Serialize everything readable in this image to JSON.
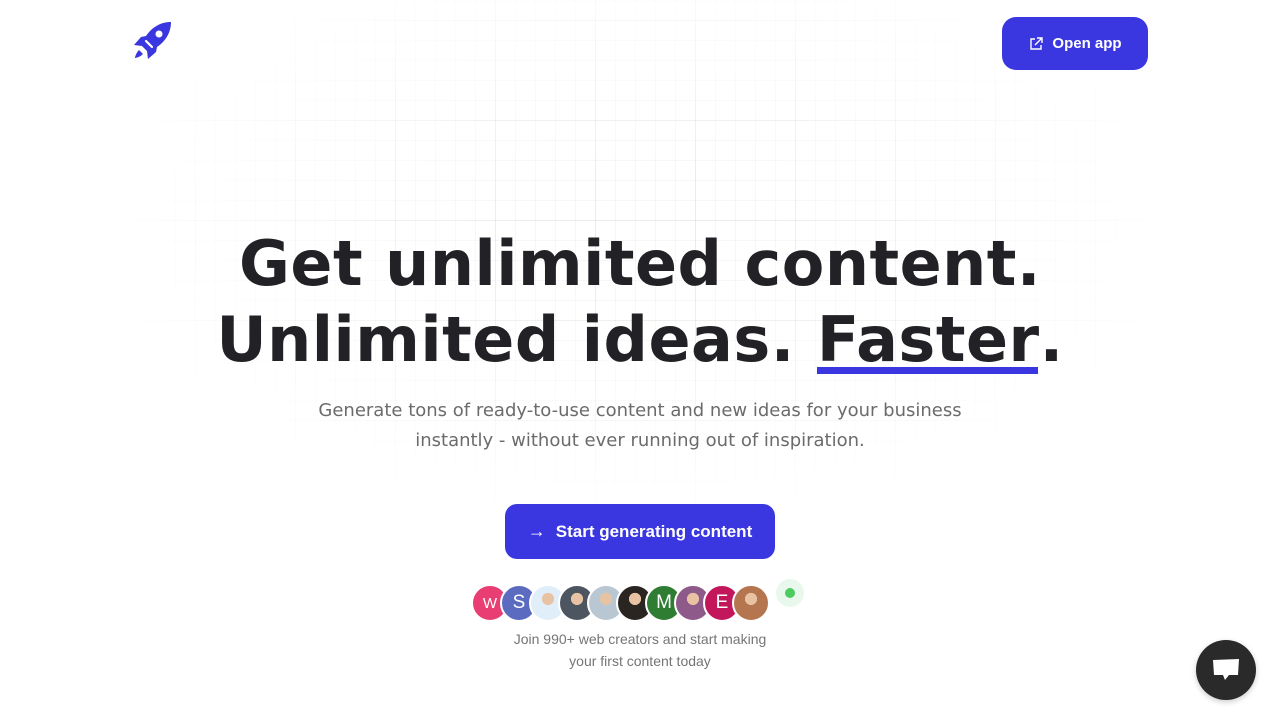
{
  "header": {
    "logo_icon": "rocket-icon",
    "open_app": {
      "label": "Open app",
      "icon": "external-link-icon"
    }
  },
  "hero": {
    "title_line1": "Get unlimited content.",
    "title_line2_prefix": "Unlimited ideas. ",
    "title_line2_highlight": "Faster",
    "title_line2_suffix": ".",
    "subtitle_line1": "Generate tons of ready-to-use content and new ideas for your business",
    "subtitle_line2": "instantly - without ever running out of inspiration.",
    "cta": {
      "label": "Start generating content",
      "icon": "arrow-right-icon"
    }
  },
  "social_proof": {
    "avatars": [
      {
        "type": "letter",
        "letter": "W",
        "color": "#e83e73"
      },
      {
        "type": "letter",
        "letter": "S",
        "color": "#5b6bbf"
      },
      {
        "type": "photo",
        "description": "cartoon avatar",
        "color": "#dfeef8"
      },
      {
        "type": "photo",
        "description": "person with helmet",
        "color": "#4d5660"
      },
      {
        "type": "photo",
        "description": "person",
        "color": "#b9c7d2"
      },
      {
        "type": "photo",
        "description": "person",
        "color": "#2b2522"
      },
      {
        "type": "letter",
        "letter": "M",
        "color": "#2e7d32"
      },
      {
        "type": "photo",
        "description": "person",
        "color": "#8e5a8a"
      },
      {
        "type": "letter",
        "letter": "E",
        "color": "#c2185b"
      },
      {
        "type": "photo",
        "description": "person",
        "color": "#b5754f"
      }
    ],
    "online_indicator_color": "#4ccb5f",
    "text_line1": "Join 990+ web creators and start making",
    "text_line2": "your first content today"
  },
  "chat_widget": {
    "icon": "chat-bubble-icon"
  },
  "colors": {
    "accent": "#3b37e0",
    "text": "#222226",
    "muted": "#6b6b6b"
  }
}
